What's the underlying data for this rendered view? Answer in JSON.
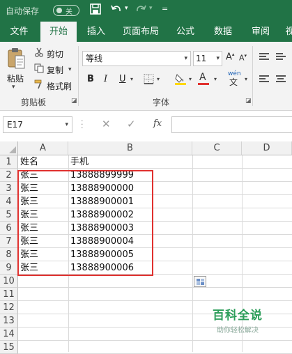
{
  "titlebar": {
    "autosave_label": "自动保存",
    "autosave_state": "关",
    "icons": [
      "save-icon",
      "undo-icon",
      "redo-icon",
      "customize-icon"
    ]
  },
  "tabs": [
    {
      "label": "文件",
      "active": false
    },
    {
      "label": "开始",
      "active": true
    },
    {
      "label": "插入",
      "active": false
    },
    {
      "label": "页面布局",
      "active": false
    },
    {
      "label": "公式",
      "active": false
    },
    {
      "label": "数据",
      "active": false
    },
    {
      "label": "审阅",
      "active": false
    },
    {
      "label": "视",
      "active": false
    }
  ],
  "ribbon": {
    "clipboard": {
      "paste": "粘贴",
      "cut": "剪切",
      "copy": "复制",
      "format_painter": "格式刷",
      "group_label": "剪贴板"
    },
    "font": {
      "font_name": "等线",
      "font_size": "11",
      "bold": "B",
      "italic": "I",
      "underline": "U",
      "font_color_glyph": "A",
      "phonetic": "wén",
      "group_label": "字体"
    }
  },
  "formula_bar": {
    "name_box": "E17",
    "fx": "fx",
    "formula": ""
  },
  "sheet": {
    "columns": [
      "A",
      "B",
      "C",
      "D"
    ],
    "rows": [
      "1",
      "2",
      "3",
      "4",
      "5",
      "6",
      "7",
      "8",
      "9",
      "10",
      "11",
      "12",
      "13",
      "14",
      "15"
    ],
    "data": [
      [
        "姓名",
        "手机"
      ],
      [
        "张三",
        "13888899999"
      ],
      [
        "张三",
        "13888900000"
      ],
      [
        "张三",
        "13888900001"
      ],
      [
        "张三",
        "13888900002"
      ],
      [
        "张三",
        "13888900003"
      ],
      [
        "张三",
        "13888900004"
      ],
      [
        "张三",
        "13888900005"
      ],
      [
        "张三",
        "13888900006"
      ]
    ]
  },
  "colors": {
    "accent": "#217346",
    "highlight_box": "#e0312f",
    "fill_yellow": "#ffd800",
    "font_red": "#e0312f"
  },
  "watermark": {
    "title": "百科全说",
    "subtitle": "助你轻松解决"
  }
}
